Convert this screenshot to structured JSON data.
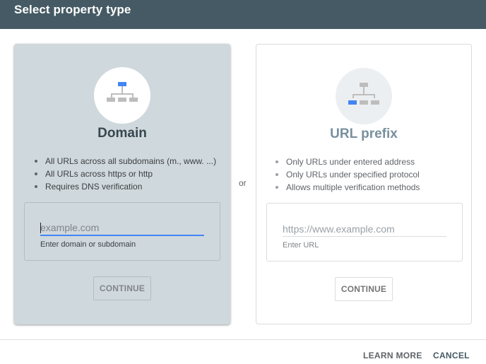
{
  "dialog": {
    "title": "Select property type"
  },
  "domain_card": {
    "icon": "sitemap-icon",
    "title": "Domain",
    "bullets": [
      "All URLs across all subdomains (m., www. ...)",
      "All URLs across https or http",
      "Requires DNS verification"
    ],
    "input": {
      "value": "",
      "placeholder": "example.com",
      "helper": "Enter domain or subdomain"
    },
    "continue_label": "CONTINUE"
  },
  "separator": "or",
  "url_card": {
    "icon": "sitemap-icon",
    "title": "URL prefix",
    "bullets": [
      "Only URLs under entered address",
      "Only URLs under specified protocol",
      "Allows multiple verification methods"
    ],
    "input": {
      "value": "",
      "placeholder": "https://www.example.com",
      "helper": "Enter URL"
    },
    "continue_label": "CONTINUE"
  },
  "footer": {
    "learn_more": "LEARN MORE",
    "cancel": "CANCEL"
  },
  "colors": {
    "header_bg": "#455a64",
    "selected_card_bg": "#cfd8dc",
    "accent_blue": "#4285f4",
    "icon_gray": "#bdbdbd"
  }
}
